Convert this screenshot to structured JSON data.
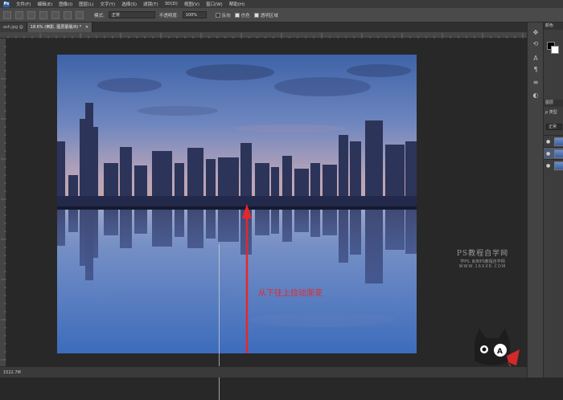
{
  "menubar": {
    "logo": "Ps",
    "items": [
      "文件(F)",
      "编辑(E)",
      "图像(I)",
      "图层(L)",
      "文字(Y)",
      "选择(S)",
      "滤镜(T)",
      "3D(D)",
      "视图(V)",
      "窗口(W)",
      "帮助(H)"
    ]
  },
  "options": {
    "mode_label": "模式:",
    "mode_value": "正常",
    "opacity_label": "不透明度:",
    "opacity_value": "100%",
    "reverse_label": "反向",
    "dither_label": "仿色",
    "transparency_label": "透明区域"
  },
  "tabs": {
    "first": "ash.jpg @",
    "second": "18.6% (倒影, 图层蒙版/8) *",
    "close_glyph": "×"
  },
  "statusbar": {
    "zoom": "1522.7M"
  },
  "canvas": {
    "annotation": "从下往上拉动渐变",
    "arrow_color": "#e8262a"
  },
  "watermark": {
    "title": "PS教程自学网",
    "subtitle": "学PS, 就到PS教程自学网",
    "url": "WWW.16XX8.COM"
  },
  "panels": {
    "color_tab": "颜色",
    "layers_tab": "图层",
    "kind_label": "ρ 类型",
    "blend_mode": "正常",
    "eye_glyph": "●"
  },
  "icons": {
    "strip": [
      "move-icon",
      "history-icon",
      "type-icon",
      "paragraph-icon",
      "properties-icon",
      "adjust-icon"
    ]
  }
}
